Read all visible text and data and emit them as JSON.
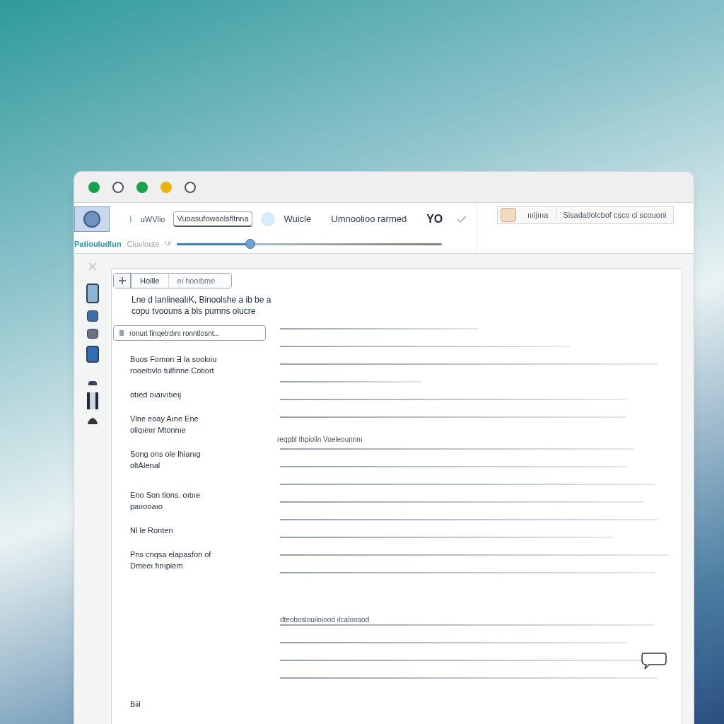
{
  "window": {
    "traffic_lights": [
      {
        "color": "#16a34a",
        "filled": true
      },
      {
        "color": "#4b5563",
        "filled": false
      },
      {
        "color": "#16a34a",
        "filled": true
      },
      {
        "color": "#eab308",
        "filled": true
      },
      {
        "color": "#4b5563",
        "filled": false
      }
    ]
  },
  "toolbar": {
    "marker": "I",
    "label": "uWVlio",
    "field_value": "Vuoasufowaolsfltnna",
    "title": "Wuicle",
    "status": "Umnoolioo rarmed",
    "badge": "YO",
    "sub_label": "Patiouludlun",
    "sub_hint": "Ciuvioute",
    "sub_unit": "Ui",
    "slider": {
      "level": 0.27
    }
  },
  "side_panel": {
    "label": "ıııijıııa",
    "text": "Sisadatlolcbof csco ci scouoni"
  },
  "form": {
    "tabs": [
      {
        "label": "Hoille",
        "selected": true
      },
      {
        "label": "ei hooibme",
        "selected": false
      }
    ],
    "intro": "Lne d lanlinealıK, Binoolshe a ib be a copu tvoouns a bls pumns olucre",
    "search_value": "ronuıt finqetrdını ronntlosnt...",
    "labels": [
      "Buos Fomon Ǝ la sooloiu rooeitıvlo tulfinne Cotiort",
      "otıed oıaıvıtıeıj",
      "Vlne eoay Aıne Ene oliqıeıır Mtonnıe",
      "Song ons ole lhianıg oltAlenal",
      "Eno Son tlons. oıtııe paııooaıo",
      "Nl le Ronten",
      "Pns cnqsa elapasfon of Dmeeı fınıpiem",
      "Biil"
    ],
    "right_caption": "reqpbl thpiolin Voeleounnnı",
    "lower_caption": "dteoboslouiloiood ılcalooaod"
  }
}
